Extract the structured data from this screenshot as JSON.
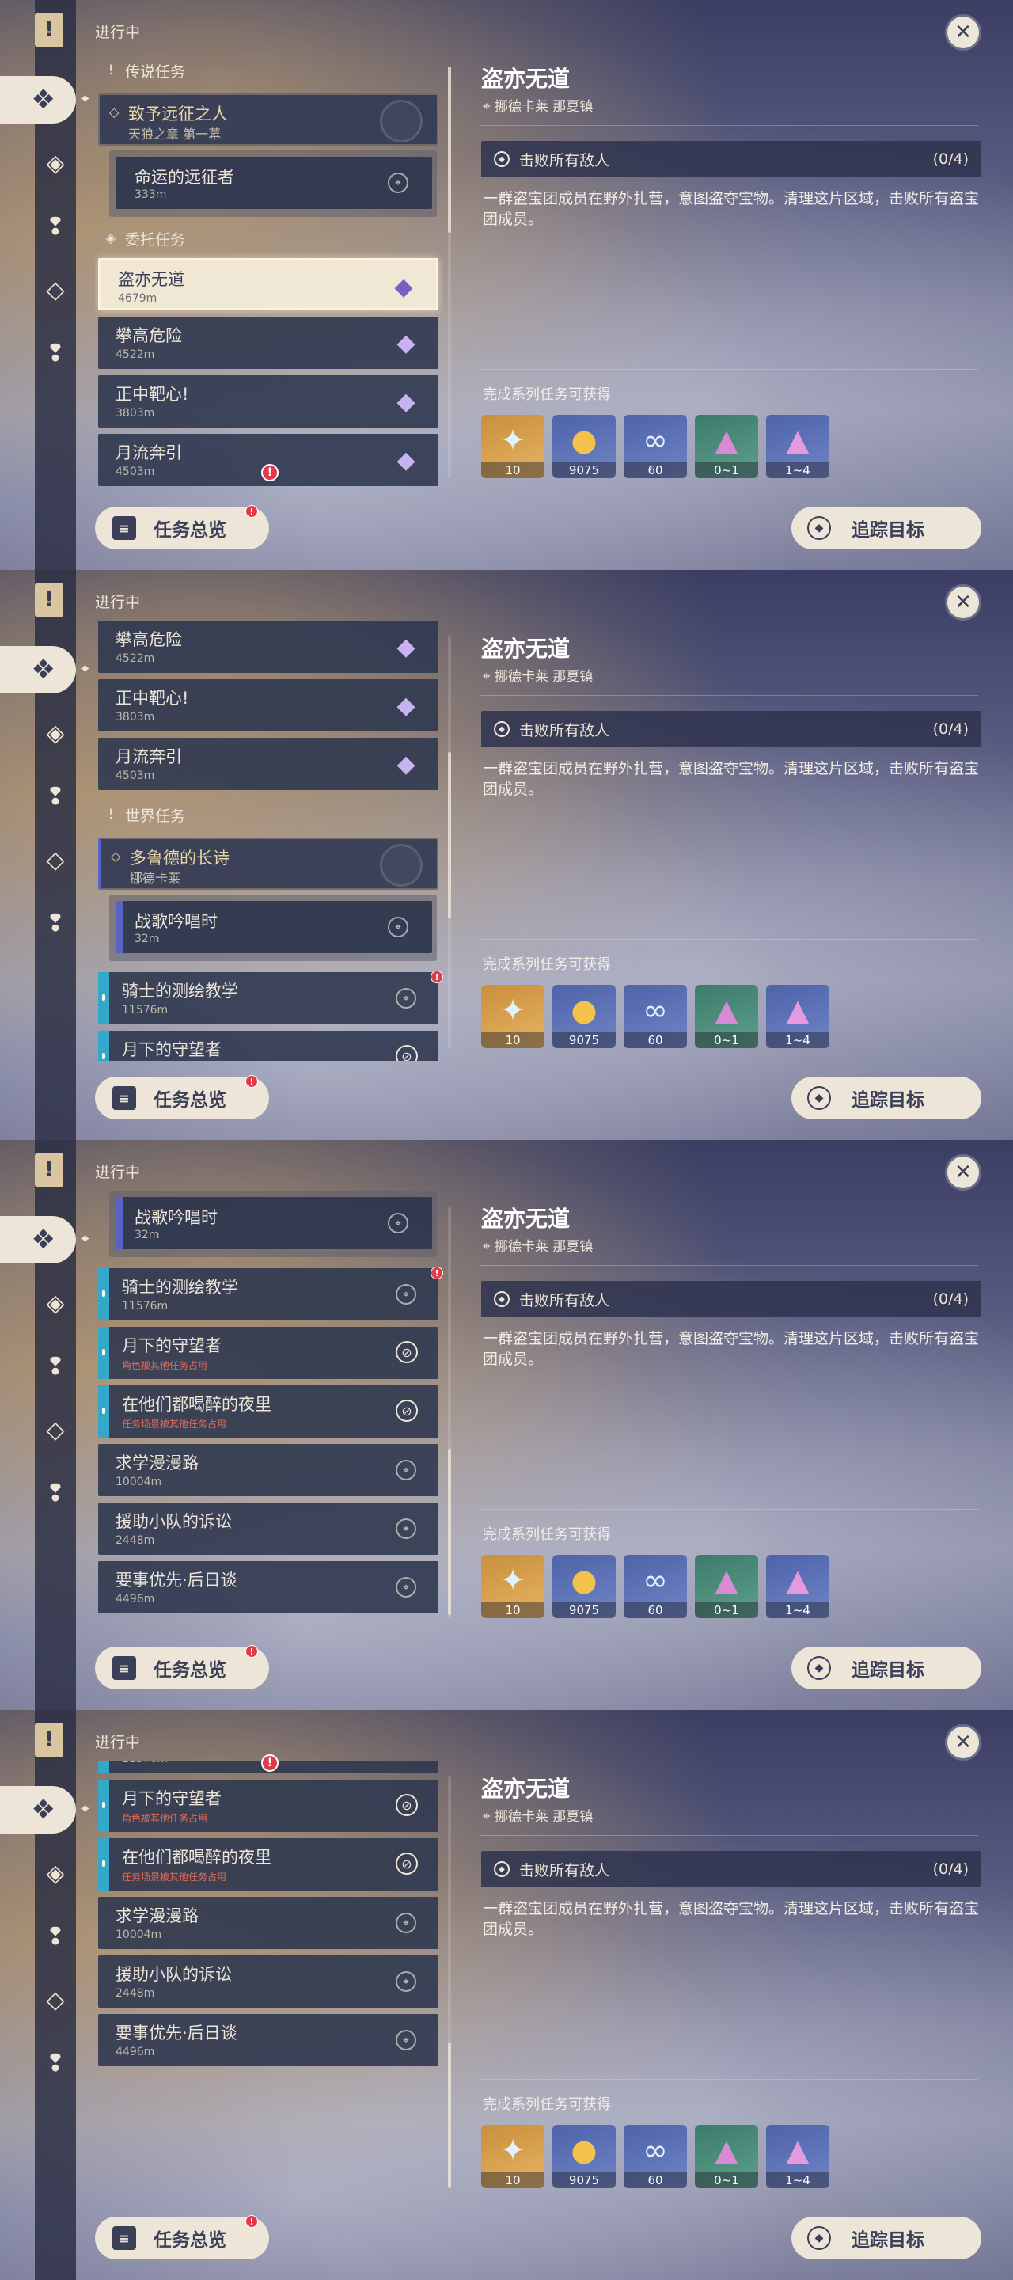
{
  "common": {
    "in_progress": "进行中",
    "overview_button": "任务总览",
    "track_button": "追踪目标",
    "close_icon": "close-icon",
    "alert_mark": "!"
  },
  "detail": {
    "title": "盗亦无道",
    "location": "挪德卡莱 那夏镇",
    "objective": "击败所有敌人",
    "objective_count": "(0/4)",
    "description": "一群盗宝团成员在野外扎营，意图盗夺宝物。清理这片区域，击败所有盗宝团成员。",
    "rewards_title": "完成系列任务可获得",
    "rewards": [
      {
        "icon": "primogem-icon",
        "qty": "10"
      },
      {
        "icon": "mora-icon",
        "qty": "9075"
      },
      {
        "icon": "companionship-exp-icon",
        "qty": "60"
      },
      {
        "icon": "crystal-chunk-icon",
        "qty": "0~1"
      },
      {
        "icon": "crystal-cluster-icon",
        "qty": "1~4"
      }
    ]
  },
  "sections": {
    "legend": "传说任务",
    "commission": "委托任务",
    "world": "世界任务"
  },
  "legend_group": {
    "name": "致予远征之人",
    "sub": "天狼之章 第一幕"
  },
  "legend_sub": {
    "name": "命运的远征者",
    "dist": "333m"
  },
  "world_group": {
    "name": "多鲁德的长诗",
    "sub": "挪德卡莱"
  },
  "world_sub": {
    "name": "战歌吟唱时",
    "dist": "32m"
  },
  "commissions": [
    {
      "name": "盗亦无道",
      "dist": "4679m"
    },
    {
      "name": "攀高危险",
      "dist": "4522m"
    },
    {
      "name": "正中靶心!",
      "dist": "3803m"
    },
    {
      "name": "月流奔引",
      "dist": "4503m"
    }
  ],
  "world_quests": [
    {
      "name": "骑士的测绘教学",
      "dist": "11576m"
    },
    {
      "name": "月下的守望者",
      "note": "角色被其他任务占用"
    },
    {
      "name": "在他们都喝醉的夜里",
      "note": "任务场景被其他任务占用"
    }
  ],
  "plain_quests": [
    {
      "name": "求学漫漫路",
      "dist": "10004m"
    },
    {
      "name": "援助小队的诉讼",
      "dist": "2448m"
    },
    {
      "name": "要事优先·后日谈",
      "dist": "4496m"
    }
  ]
}
